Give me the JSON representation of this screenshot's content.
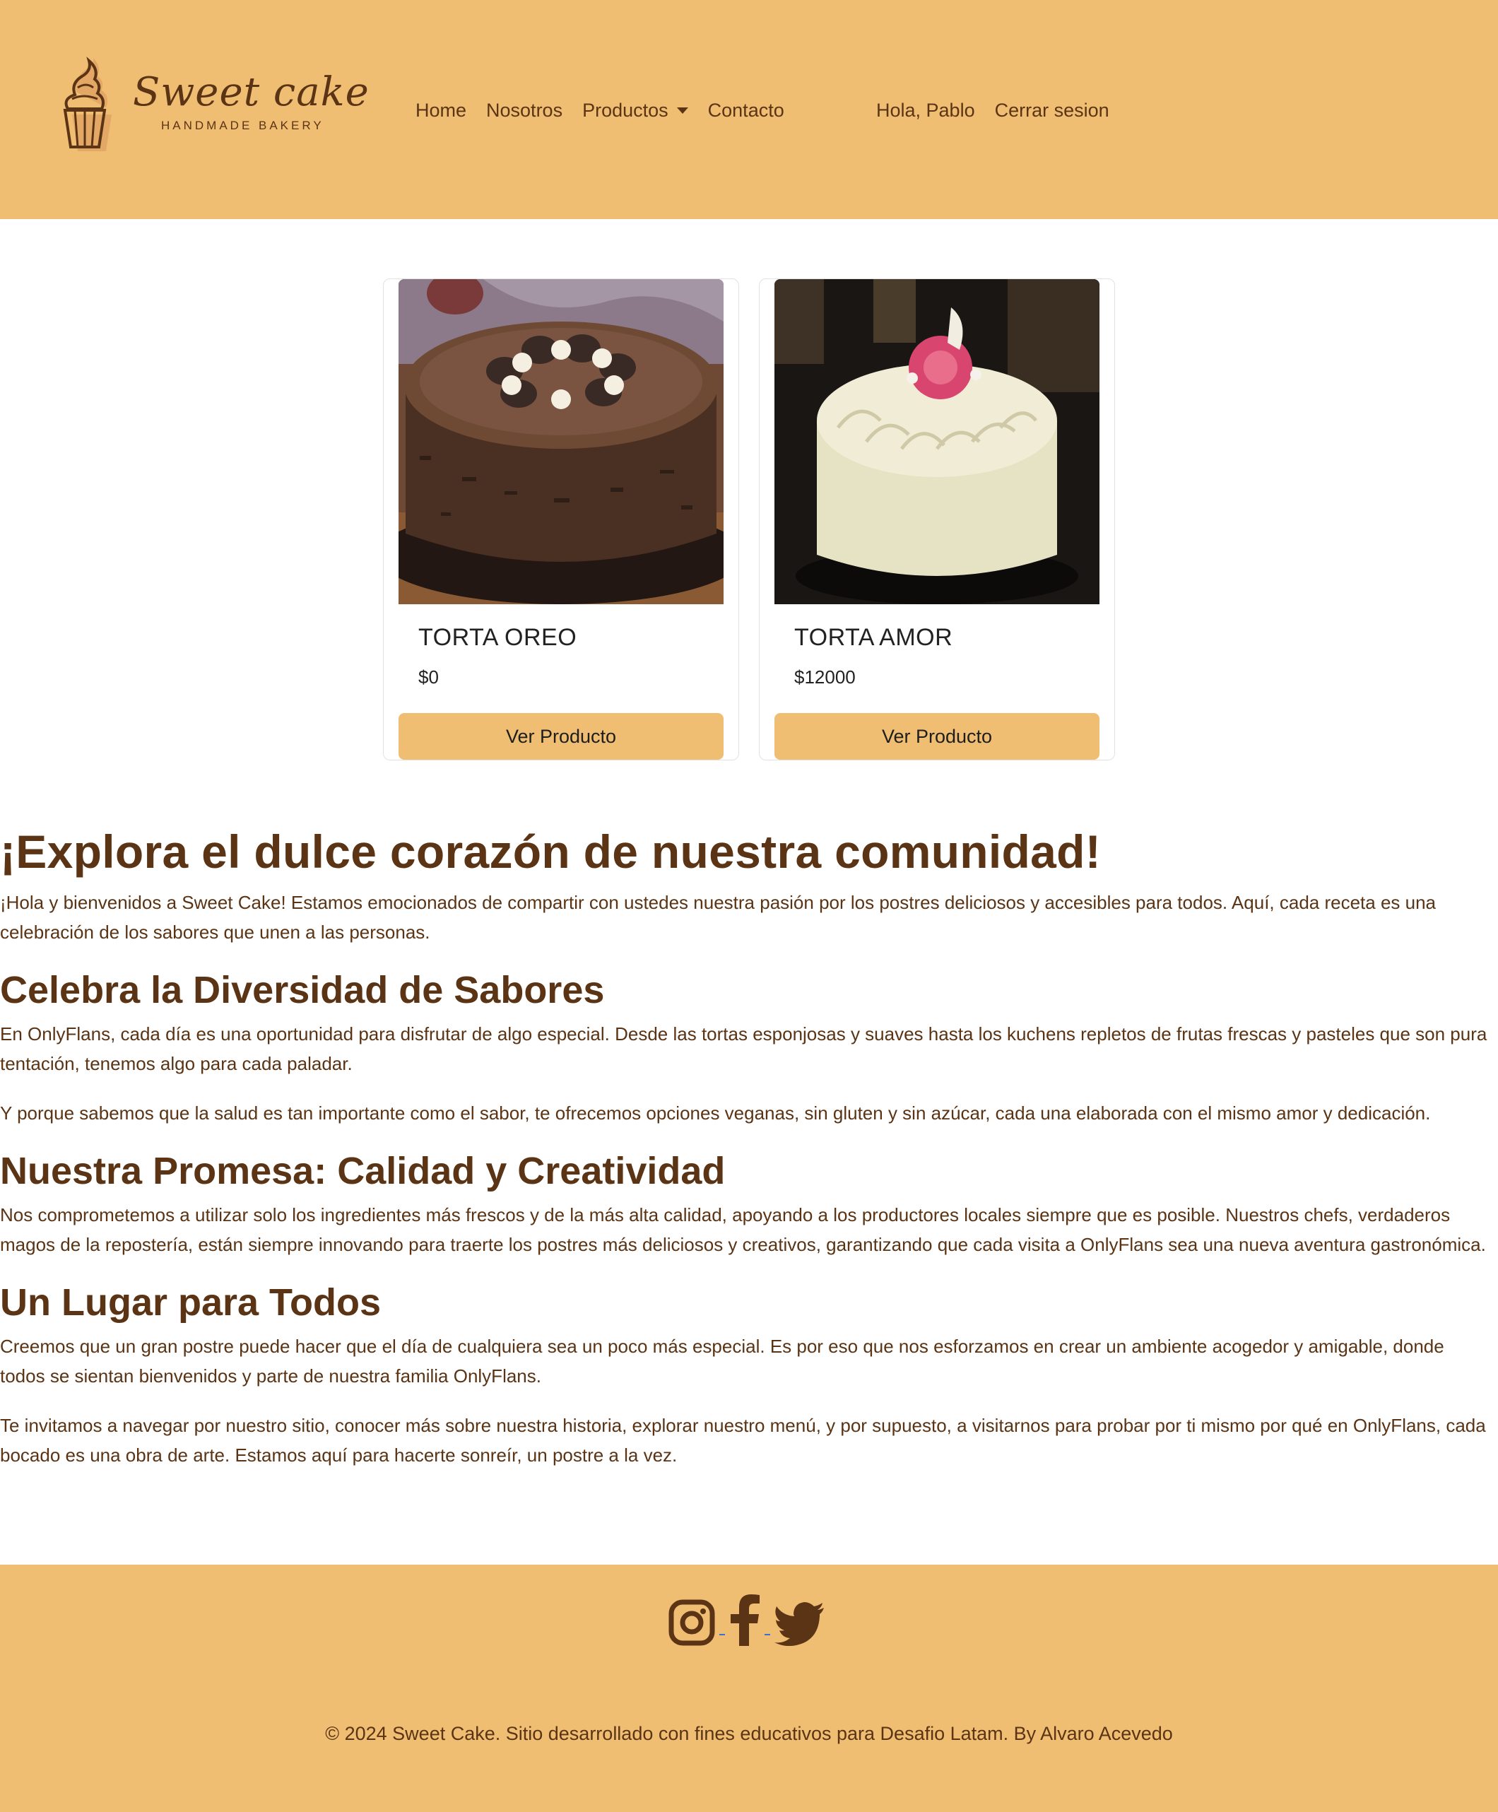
{
  "header": {
    "logo": {
      "script": "Sweet cake",
      "subtitle": "HANDMADE BAKERY"
    },
    "nav": [
      "Home",
      "Nosotros",
      "Productos",
      "Contacto"
    ],
    "greeting": "Hola, Pablo",
    "logout": "Cerrar sesion"
  },
  "products": [
    {
      "name": "TORTA OREO",
      "price": "$0",
      "button": "Ver Producto"
    },
    {
      "name": "TORTA AMOR",
      "price": "$12000",
      "button": "Ver Producto"
    }
  ],
  "content": {
    "title": "¡Explora el dulce corazón de nuestra comunidad!",
    "intro": "¡Hola y bienvenidos a Sweet Cake! Estamos emocionados de compartir con ustedes nuestra pasión por los postres deliciosos y accesibles para todos. Aquí, cada receta es una celebración de los sabores que unen a las personas.",
    "sections": [
      {
        "heading": "Celebra la Diversidad de Sabores",
        "paragraphs": [
          "En OnlyFlans, cada día es una oportunidad para disfrutar de algo especial. Desde las tortas esponjosas y suaves hasta los kuchens repletos de frutas frescas y pasteles que son pura tentación, tenemos algo para cada paladar.",
          "Y porque sabemos que la salud es tan importante como el sabor, te ofrecemos opciones veganas, sin gluten y sin azúcar, cada una elaborada con el mismo amor y dedicación."
        ]
      },
      {
        "heading": "Nuestra Promesa: Calidad y Creatividad",
        "paragraphs": [
          "Nos comprometemos a utilizar solo los ingredientes más frescos y de la más alta calidad, apoyando a los productores locales siempre que es posible. Nuestros chefs, verdaderos magos de la repostería, están siempre innovando para traerte los postres más deliciosos y creativos, garantizando que cada visita a OnlyFlans sea una nueva aventura gastronómica."
        ]
      },
      {
        "heading": "Un Lugar para Todos",
        "paragraphs": [
          "Creemos que un gran postre puede hacer que el día de cualquiera sea un poco más especial. Es por eso que nos esforzamos en crear un ambiente acogedor y amigable, donde todos se sientan bienvenidos y parte de nuestra familia OnlyFlans.",
          "Te invitamos a navegar por nuestro sitio, conocer más sobre nuestra historia, explorar nuestro menú, y por supuesto, a visitarnos para probar por ti mismo por qué en OnlyFlans, cada bocado es una obra de arte. Estamos aquí para hacerte sonreír, un postre a la vez."
        ]
      }
    ]
  },
  "footer": {
    "social_icons": [
      "instagram-icon",
      "facebook-icon",
      "twitter-icon"
    ],
    "copyright": "© 2024 Sweet Cake. Sitio desarrollado con fines educativos para Desafio Latam. By Alvaro Acevedo"
  },
  "colors": {
    "brand": "#f0be72",
    "text": "#5a3414"
  }
}
